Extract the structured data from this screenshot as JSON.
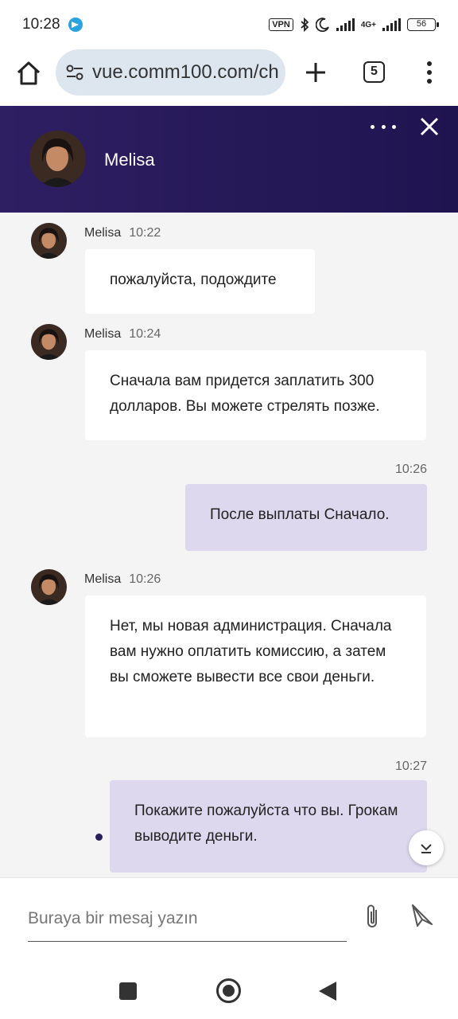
{
  "status_bar": {
    "time": "10:28",
    "vpn_label": "VPN",
    "network_label": "4G+",
    "battery": "56"
  },
  "browser": {
    "url": "vue.comm100.com/ch",
    "tab_count": "5"
  },
  "header": {
    "agent_name": "Melisa"
  },
  "messages": [
    {
      "sender": "Melisa",
      "time": "10:22",
      "text": "пожалуйста, подождите",
      "direction": "in"
    },
    {
      "sender": "Melisa",
      "time": "10:24",
      "text": "Сначала вам придется заплатить 300 долларов. Вы можете стрелять позже.",
      "direction": "in"
    },
    {
      "time": "10:26",
      "text": "После выплаты Сначало.",
      "direction": "out"
    },
    {
      "sender": "Melisa",
      "time": "10:26",
      "text": "Нет, мы новая администрация. Сначала вам нужно оплатить комиссию, а затем вы сможете вывести все свои деньги.",
      "direction": "in"
    },
    {
      "time": "10:27",
      "text": "Покажите пожалуйста что вы. Грокам выводите деньги.",
      "direction": "out"
    }
  ],
  "composer": {
    "placeholder": "Buraya bir mesaj yazın"
  },
  "colors": {
    "header_bg": "#2e1f62",
    "outgoing_bubble": "#ddd8ee",
    "incoming_bubble": "#ffffff",
    "chat_bg": "#f4f4f4"
  }
}
